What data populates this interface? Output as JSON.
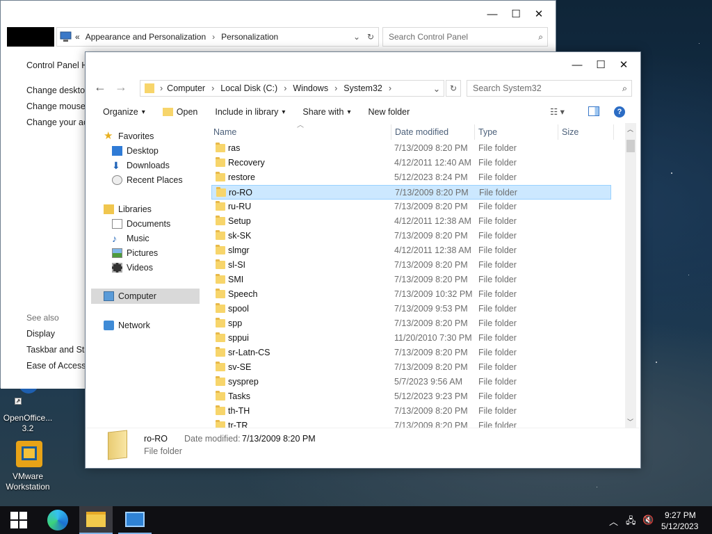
{
  "desktop": {
    "icons": [
      {
        "label": "OpenOffice.org 3.2",
        "line1": "OpenOffice...",
        "line2": "3.2"
      },
      {
        "label": "VMware Workstation",
        "line1": "VMware",
        "line2": "Workstation"
      }
    ]
  },
  "control_panel": {
    "address_chevron": "«",
    "breadcrumb": [
      "Appearance and Personalization",
      "Personalization"
    ],
    "search_placeholder": "Search Control Panel",
    "left_links": [
      "Control Panel H",
      "Change desktop",
      "Change mouse p",
      "Change your acc"
    ],
    "see_also_title": "See also",
    "see_also_links": [
      "Display",
      "Taskbar and Star",
      "Ease of Access C"
    ]
  },
  "explorer": {
    "breadcrumb": [
      "Computer",
      "Local Disk (C:)",
      "Windows",
      "System32"
    ],
    "search_placeholder": "Search System32",
    "toolbar": {
      "organize": "Organize",
      "open": "Open",
      "include": "Include in library",
      "share": "Share with",
      "new_folder": "New folder"
    },
    "nav": {
      "favorites": "Favorites",
      "favorites_items": [
        "Desktop",
        "Downloads",
        "Recent Places"
      ],
      "libraries": "Libraries",
      "libraries_items": [
        "Documents",
        "Music",
        "Pictures",
        "Videos"
      ],
      "computer": "Computer",
      "network": "Network"
    },
    "columns": [
      "Name",
      "Date modified",
      "Type",
      "Size"
    ],
    "rows": [
      {
        "name": "ras",
        "date": "7/13/2009 8:20 PM",
        "type": "File folder"
      },
      {
        "name": "Recovery",
        "date": "4/12/2011 12:40 AM",
        "type": "File folder"
      },
      {
        "name": "restore",
        "date": "5/12/2023 8:24 PM",
        "type": "File folder"
      },
      {
        "name": "ro-RO",
        "date": "7/13/2009 8:20 PM",
        "type": "File folder"
      },
      {
        "name": "ru-RU",
        "date": "7/13/2009 8:20 PM",
        "type": "File folder"
      },
      {
        "name": "Setup",
        "date": "4/12/2011 12:38 AM",
        "type": "File folder"
      },
      {
        "name": "sk-SK",
        "date": "7/13/2009 8:20 PM",
        "type": "File folder"
      },
      {
        "name": "slmgr",
        "date": "4/12/2011 12:38 AM",
        "type": "File folder"
      },
      {
        "name": "sl-SI",
        "date": "7/13/2009 8:20 PM",
        "type": "File folder"
      },
      {
        "name": "SMI",
        "date": "7/13/2009 8:20 PM",
        "type": "File folder"
      },
      {
        "name": "Speech",
        "date": "7/13/2009 10:32 PM",
        "type": "File folder"
      },
      {
        "name": "spool",
        "date": "7/13/2009 9:53 PM",
        "type": "File folder"
      },
      {
        "name": "spp",
        "date": "7/13/2009 8:20 PM",
        "type": "File folder"
      },
      {
        "name": "sppui",
        "date": "11/20/2010 7:30 PM",
        "type": "File folder"
      },
      {
        "name": "sr-Latn-CS",
        "date": "7/13/2009 8:20 PM",
        "type": "File folder"
      },
      {
        "name": "sv-SE",
        "date": "7/13/2009 8:20 PM",
        "type": "File folder"
      },
      {
        "name": "sysprep",
        "date": "5/7/2023 9:56 AM",
        "type": "File folder"
      },
      {
        "name": "Tasks",
        "date": "5/12/2023 9:23 PM",
        "type": "File folder"
      },
      {
        "name": "th-TH",
        "date": "7/13/2009 8:20 PM",
        "type": "File folder"
      },
      {
        "name": "tr-TR",
        "date": "7/13/2009 8:20 PM",
        "type": "File folder"
      }
    ],
    "selected_row_name": "ro-RO",
    "details": {
      "name": "ro-RO",
      "date_label": "Date modified:",
      "date_value": "7/13/2009 8:20 PM",
      "type": "File folder"
    }
  },
  "taskbar": {
    "time": "9:27 PM",
    "date": "5/12/2023"
  }
}
